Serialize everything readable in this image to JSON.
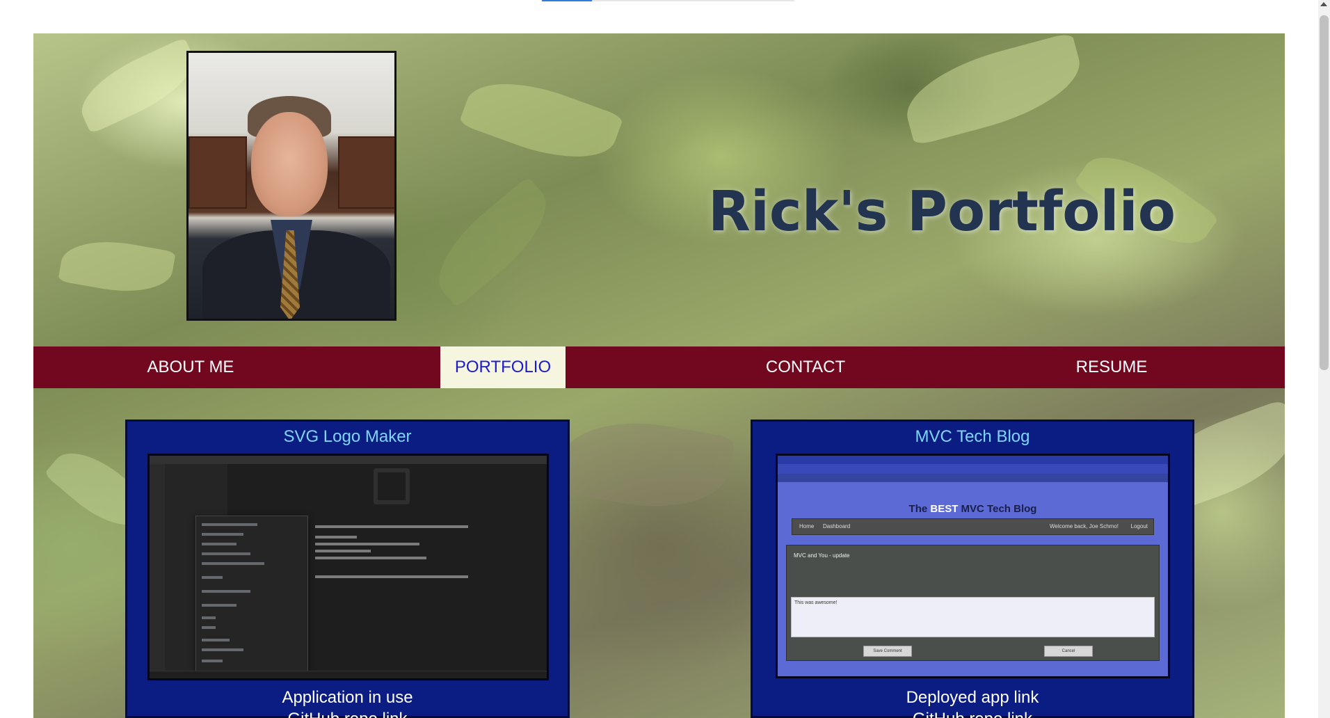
{
  "header": {
    "title": "Rick's Portfolio",
    "profile_photo": "profile-photo"
  },
  "nav": {
    "items": [
      {
        "label": "ABOUT ME",
        "active": false
      },
      {
        "label": "PORTFOLIO",
        "active": true
      },
      {
        "label": "CONTACT",
        "active": false
      },
      {
        "label": "RESUME",
        "active": false
      }
    ],
    "active_bg": "#f6f6e0",
    "bar_color": "#720820"
  },
  "projects": [
    {
      "title": "SVG Logo Maker",
      "screenshot_icon": "vscode-screenshot",
      "caption": "Application in use",
      "link_partial": "GitHub repo link"
    },
    {
      "title": "MVC Tech Blog",
      "screenshot_icon": "browser-screenshot",
      "caption": "Deployed app link",
      "link_partial": "GitHub repo link",
      "screenshot_text": {
        "heading_pre": "The ",
        "heading_best": "BEST",
        "heading_post": " MVC Tech Blog",
        "nav_home": "Home",
        "nav_dashboard": "Dashboard",
        "nav_welcome": "Welcome back, Joe Schmo!",
        "nav_logout": "Logout",
        "post_title": "MVC and You - update",
        "comment_text": "This was awesome!",
        "save_button": "Save Comment",
        "cancel_button": "Cancel"
      }
    }
  ],
  "colors": {
    "card_bg": "#0b1d82",
    "card_title": "#7fd6ff",
    "title_color": "#22344f"
  }
}
